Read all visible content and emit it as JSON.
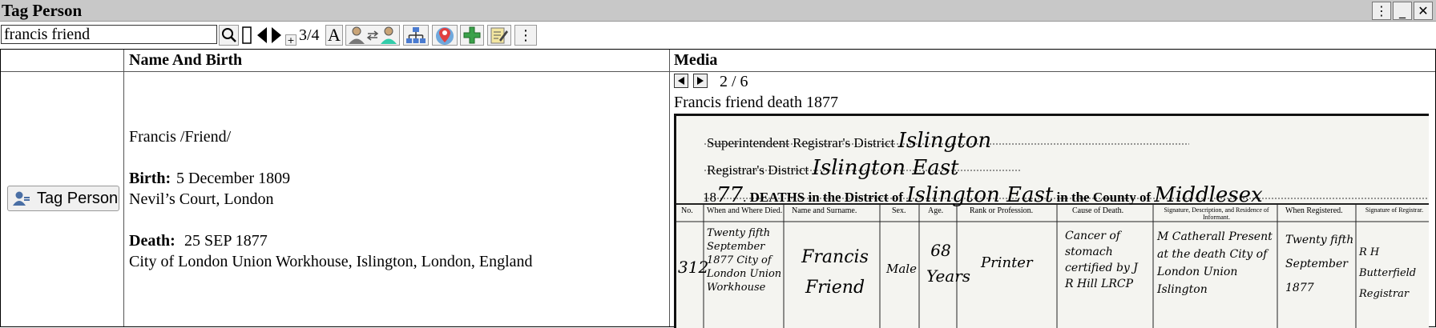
{
  "window": {
    "title": "Tag Person"
  },
  "toolbar": {
    "search_value": "francis friend",
    "counter": "3/4",
    "font_button": "A"
  },
  "table": {
    "col_name_header": "Name And Birth",
    "col_media_header": "Media",
    "tag_button_label": "Tag Person"
  },
  "person": {
    "name": "Francis /Friend/",
    "birth_label": "Birth:",
    "birth_date": "5 December 1809",
    "birth_place": "Nevil’s Court, London",
    "death_label": "Death:",
    "death_date": "25 SEP 1877",
    "death_place": "City of London Union Workhouse, Islington, London, England"
  },
  "media": {
    "position": "2 / 6",
    "caption": "Francis friend death 1877",
    "document": {
      "line1_label": "Superintendent Registrar's District",
      "line1_value": "Islington",
      "line2_label": "Registrar's District",
      "line2_value": "Islington East",
      "year_prefix": "18",
      "year_suffix": "77",
      "deaths_text": "DEATHS in the District of",
      "district_value": "Islington East",
      "county_text": "in the County of",
      "county_value": "Middlesex",
      "columns": [
        "No.",
        "When and Where Died.",
        "Name and Surname.",
        "Sex.",
        "Age.",
        "Rank or Profession.",
        "Cause of Death.",
        "Signature, Description, and Residence of Informant.",
        "When Registered.",
        "Signature of Registrar."
      ],
      "entry": {
        "no": "312",
        "when_where": "Twenty fifth September 1877 City of London Union Workhouse",
        "name": "Francis Friend",
        "sex": "Male",
        "age": "68 Years",
        "rank": "Printer",
        "cause": "Cancer of stomach certified by J R Hill LRCP",
        "informant": "M Catherall Present at the death City of London Union Islington",
        "registered": "Twenty fifth September 1877",
        "registrar": "R H Butterfield Registrar"
      }
    }
  }
}
